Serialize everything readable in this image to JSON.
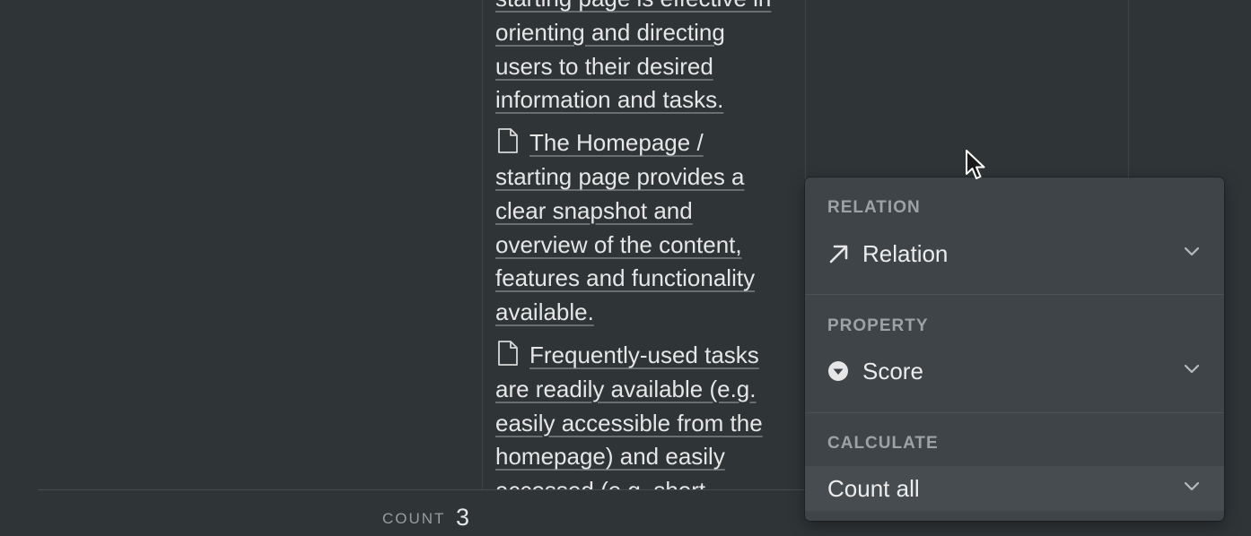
{
  "relation_cell": {
    "items": [
      {
        "text": "starting page is effective in orienting and directing users to their desired information and tasks.",
        "has_icon": false
      },
      {
        "text": "The Homepage / starting page provides a clear snapshot and overview of the content, features and functionality available.",
        "has_icon": true
      },
      {
        "text": "Frequently-used tasks are readily available (e.g. easily accessible from the homepage) and easily accessed (e.g. short",
        "has_icon": true
      }
    ]
  },
  "footer": {
    "count_label": "COUNT",
    "count_value": "3"
  },
  "calc_panel": {
    "relation": {
      "section_label": "RELATION",
      "value": "Relation",
      "icon": "arrow-up-right-icon"
    },
    "property": {
      "section_label": "PROPERTY",
      "value": "Score",
      "icon": "select-property-icon"
    },
    "calculate": {
      "section_label": "CALCULATE",
      "value": "Count all"
    }
  },
  "colors": {
    "background": "#2f3437",
    "panel": "#3f4448",
    "panel_highlight": "#474c50",
    "muted_text": "#9fa2a4"
  }
}
